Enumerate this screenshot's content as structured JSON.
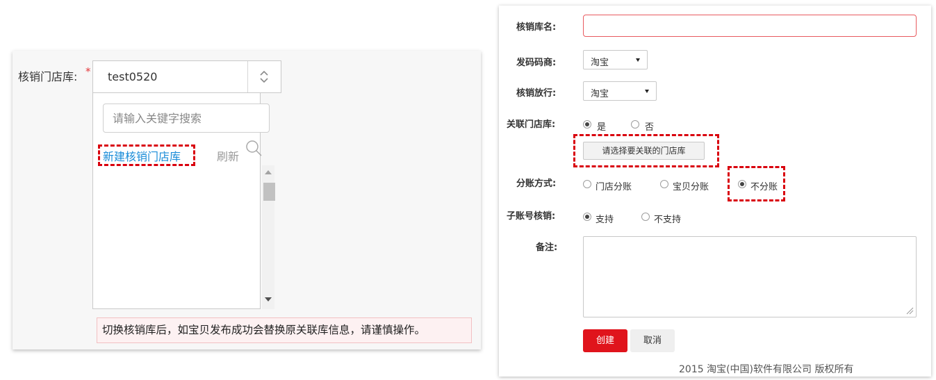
{
  "left": {
    "store_label": "核销门店库:",
    "required_mark": "*",
    "selected_store": "test0520",
    "search_placeholder": "请输入关键字搜索",
    "new_store_link": "新建核销门店库",
    "refresh_link": "刷新",
    "warning": "切换核销库后，如宝贝发布成功会替换原关联库信息，请谨慎操作。"
  },
  "form": {
    "lib_name_label": "核销库名:",
    "code_issuer_label": "发码码商:",
    "code_issuer_value": "淘宝",
    "release_label": "核销放行:",
    "release_value": "淘宝",
    "link_store_label": "关联门店库:",
    "link_store_options": [
      "是",
      "否"
    ],
    "pick_store_button": "请选择要关联的门店库",
    "split_label": "分账方式:",
    "split_options": [
      "门店分账",
      "宝贝分账",
      "不分账"
    ],
    "sub_account_label": "子账号核销:",
    "sub_account_options": [
      "支持",
      "不支持"
    ],
    "remark_label": "备注:",
    "create_button": "创建",
    "cancel_button": "取消",
    "footer": "2015 淘宝(中国)软件有限公司 版权所有"
  },
  "colors": {
    "accent_red": "#e0141c",
    "link_blue": "#1a8cd8",
    "dash_highlight": "#d9000d"
  }
}
